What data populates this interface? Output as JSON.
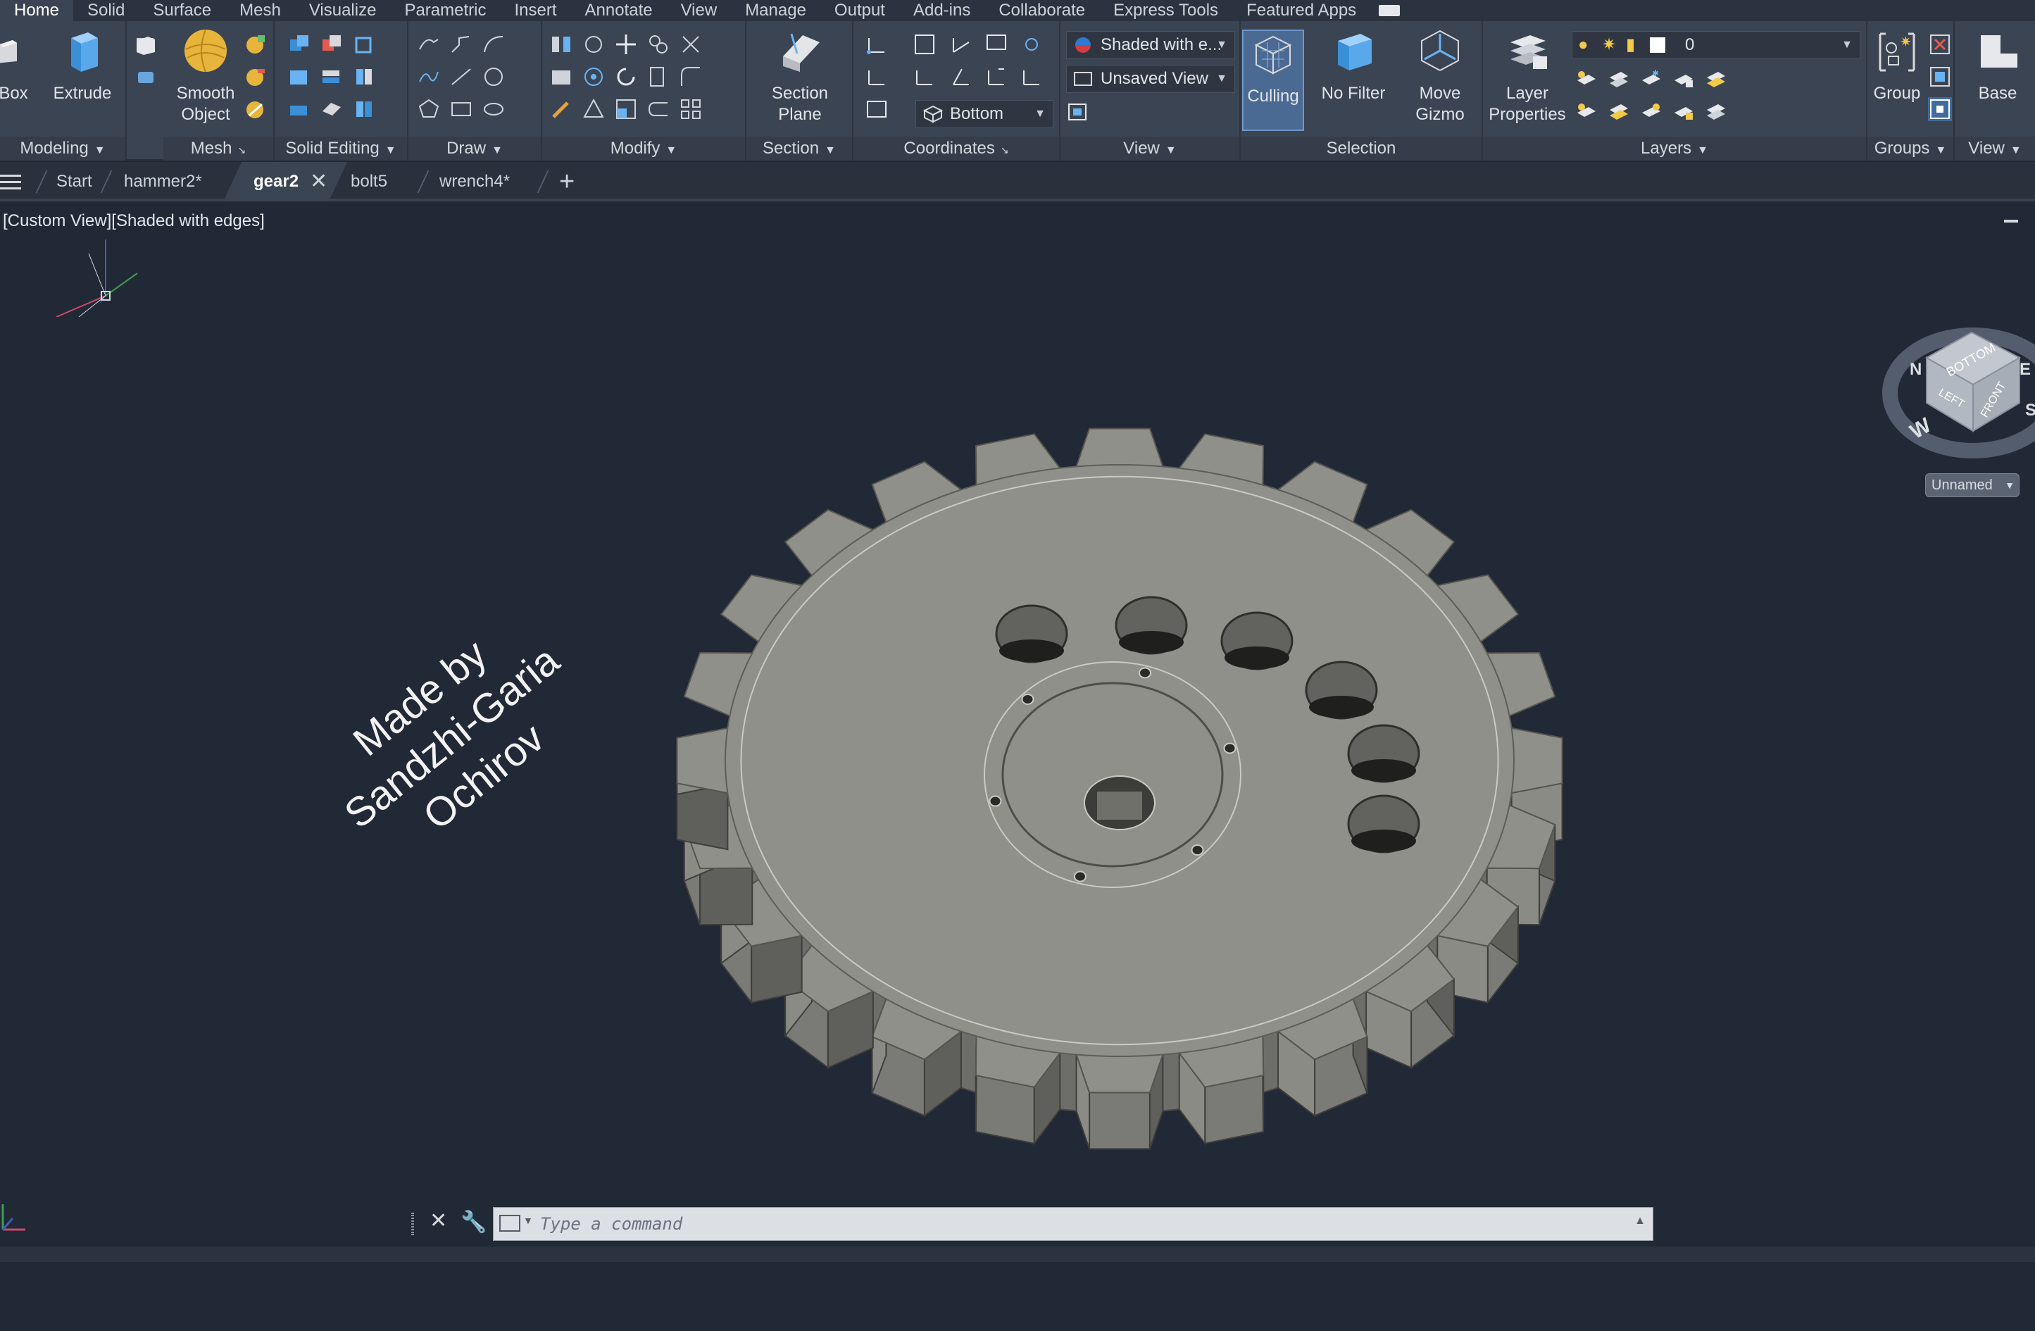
{
  "menubar": {
    "tabs": [
      "Home",
      "Solid",
      "Surface",
      "Mesh",
      "Visualize",
      "Parametric",
      "Insert",
      "Annotate",
      "View",
      "Manage",
      "Output",
      "Add-ins",
      "Collaborate",
      "Express Tools",
      "Featured Apps"
    ],
    "active": "Home"
  },
  "ribbon": {
    "modeling": {
      "title": "Modeling",
      "box_label": "Box",
      "extrude_label": "Extrude"
    },
    "mesh": {
      "title": "Mesh",
      "smooth_label_1": "Smooth",
      "smooth_label_2": "Object"
    },
    "solid_editing": {
      "title": "Solid Editing"
    },
    "draw": {
      "title": "Draw"
    },
    "modify": {
      "title": "Modify"
    },
    "section": {
      "title": "Section",
      "plane_label_1": "Section",
      "plane_label_2": "Plane"
    },
    "coordinates": {
      "title": "Coordinates",
      "ucs_value": "Bottom"
    },
    "view": {
      "title": "View",
      "visual_style": "Shaded with e...",
      "named_view": "Unsaved View"
    },
    "selection": {
      "title": "Selection",
      "culling_label": "Culling",
      "filter_label": "No Filter",
      "gizmo_label_1": "Move",
      "gizmo_label_2": "Gizmo"
    },
    "layers": {
      "title": "Layers",
      "properties_label_1": "Layer",
      "properties_label_2": "Properties",
      "current_layer": "0"
    },
    "groups": {
      "title": "Groups",
      "group_label": "Group"
    },
    "view2": {
      "title": "View",
      "base_label": "Base"
    }
  },
  "doctabs": {
    "tabs": [
      "Start",
      "hammer2*",
      "gear2",
      "bolt5",
      "wrench4*"
    ],
    "active": "gear2"
  },
  "viewport": {
    "label": "[Custom View][Shaded with edges]",
    "annotation_lines": [
      "Made by",
      "Sandzhi-Garia",
      "Ochirov"
    ],
    "viewcube": {
      "top_face": "BOTTOM",
      "left_face": "LEFT",
      "right_face": "FRONT",
      "compass_w": "W",
      "compass_n": "N",
      "compass_e": "E",
      "compass_s": "S"
    },
    "ucs_menu": "Unnamed"
  },
  "command": {
    "placeholder": "Type a command"
  },
  "colors": {
    "background": "#212836",
    "ribbon": "#3b4453",
    "gear": "#8f908a",
    "accent": "#3b8fd6"
  }
}
